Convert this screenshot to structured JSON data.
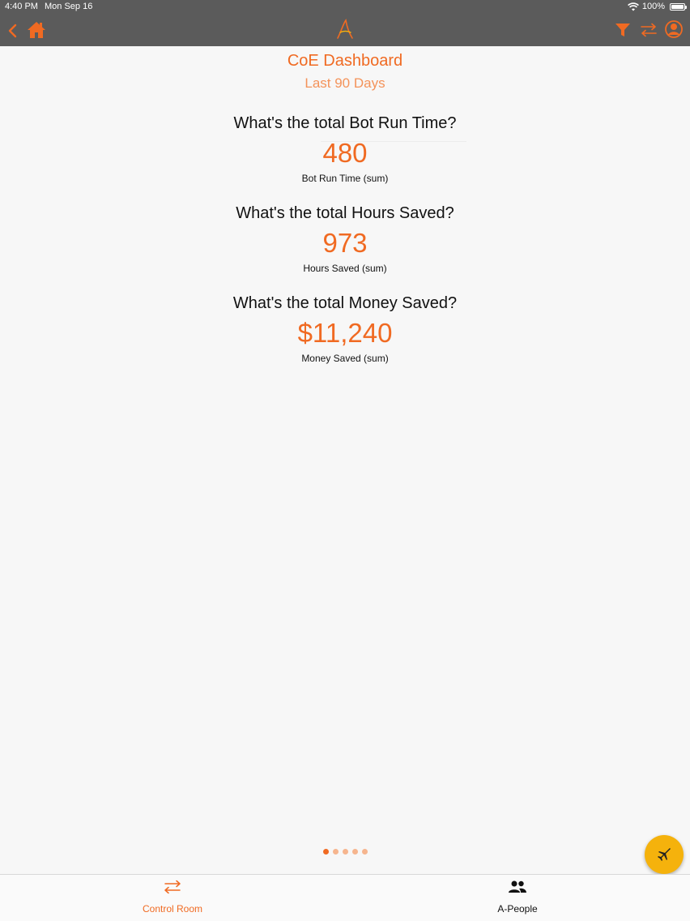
{
  "status_bar": {
    "time": "4:40 PM",
    "date": "Mon Sep 16",
    "battery": "100%",
    "icons": [
      "wifi-icon",
      "battery-icon"
    ]
  },
  "nav_bar": {
    "icons": [
      "back-icon",
      "home-icon",
      "app-logo-icon",
      "filter-icon",
      "swap-icon",
      "account-icon"
    ]
  },
  "dashboard": {
    "title": "CoE Dashboard",
    "subtitle": "Last 90 Days",
    "kpis": [
      {
        "question": "What's the total Bot Run Time?",
        "value": "480",
        "label": "Bot Run Time (sum)"
      },
      {
        "question": "What's the total Hours Saved?",
        "value": "973",
        "label": "Hours Saved (sum)"
      },
      {
        "question": "What's the total Money Saved?",
        "value": "$11,240",
        "label": "Money Saved (sum)"
      }
    ]
  },
  "pager": {
    "count": 5,
    "active_index": 0
  },
  "fab": {
    "icon": "jet-icon"
  },
  "tab_bar": {
    "tabs": [
      {
        "label": "Control Room",
        "icon": "swap-icon",
        "active": true
      },
      {
        "label": "A-People",
        "icon": "people-icon",
        "active": false
      }
    ]
  },
  "colors": {
    "accent": "#f06a22",
    "accent_light": "#f4935a",
    "nav_background": "#5b5b5b",
    "fab": "#f5b20c"
  }
}
